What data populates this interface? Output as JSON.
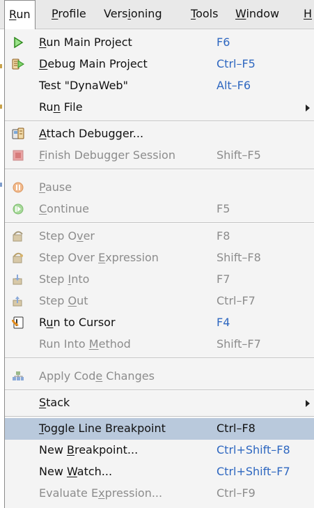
{
  "menubar": {
    "items": [
      {
        "pre": "",
        "u": "R",
        "post": "un"
      },
      {
        "pre": "",
        "u": "P",
        "post": "rofile"
      },
      {
        "pre": "Vers",
        "u": "i",
        "post": "oning"
      },
      {
        "pre": "",
        "u": "T",
        "post": "ools"
      },
      {
        "pre": "",
        "u": "W",
        "post": "indow"
      },
      {
        "pre": "",
        "u": "H",
        "post": ""
      }
    ]
  },
  "menu": {
    "items": [
      {
        "pre": "",
        "u": "R",
        "post": "un Main Project",
        "shortcut": "F6"
      },
      {
        "pre": "",
        "u": "D",
        "post": "ebug Main Project",
        "shortcut": "Ctrl–F5"
      },
      {
        "pre": "Test \"DynaWeb\"",
        "u": "",
        "post": "",
        "shortcut": "Alt–F6"
      },
      {
        "pre": "Ru",
        "u": "n",
        "post": " File",
        "shortcut": ""
      },
      {
        "pre": "",
        "u": "A",
        "post": "ttach Debugger...",
        "shortcut": ""
      },
      {
        "pre": "",
        "u": "F",
        "post": "inish Debugger Session",
        "shortcut": "Shift–F5"
      },
      {
        "pre": "",
        "u": "P",
        "post": "ause",
        "shortcut": ""
      },
      {
        "pre": "",
        "u": "C",
        "post": "ontinue",
        "shortcut": "F5"
      },
      {
        "pre": "Step O",
        "u": "v",
        "post": "er",
        "shortcut": "F8"
      },
      {
        "pre": "Step Over ",
        "u": "E",
        "post": "xpression",
        "shortcut": "Shift–F8"
      },
      {
        "pre": "Step ",
        "u": "I",
        "post": "nto",
        "shortcut": "F7"
      },
      {
        "pre": "Step ",
        "u": "O",
        "post": "ut",
        "shortcut": "Ctrl–F7"
      },
      {
        "pre": "R",
        "u": "u",
        "post": "n to Cursor",
        "shortcut": "F4"
      },
      {
        "pre": "Run Into ",
        "u": "M",
        "post": "ethod",
        "shortcut": "Shift–F7"
      },
      {
        "pre": "Apply Cod",
        "u": "e",
        "post": " Changes",
        "shortcut": ""
      },
      {
        "pre": "",
        "u": "S",
        "post": "tack",
        "shortcut": ""
      },
      {
        "pre": "",
        "u": "T",
        "post": "oggle Line Breakpoint",
        "shortcut": "Ctrl–F8"
      },
      {
        "pre": "New ",
        "u": "B",
        "post": "reakpoint...",
        "shortcut": "Ctrl+Shift–F8"
      },
      {
        "pre": "New ",
        "u": "W",
        "post": "atch...",
        "shortcut": "Ctrl+Shift–F7"
      },
      {
        "pre": "Evaluate E",
        "u": "x",
        "post": "pression...",
        "shortcut": "Ctrl–F9"
      }
    ]
  },
  "colors": {
    "shortcut": "#2e67c0",
    "disabled": "#8c8c8c",
    "highlight": "#b9c9dc"
  }
}
